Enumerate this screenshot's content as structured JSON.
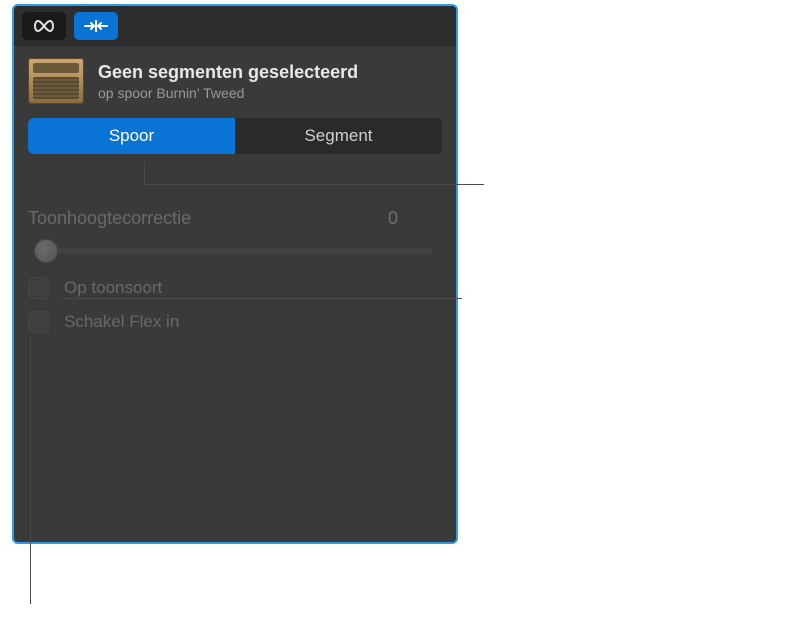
{
  "header": {
    "title": "Geen segmenten geselecteerd",
    "subtitle": "op spoor Burnin' Tweed"
  },
  "segmenter": {
    "track_label": "Spoor",
    "segment_label": "Segment"
  },
  "pitch": {
    "label": "Toonhoogtecorrectie",
    "value": "0"
  },
  "checks": {
    "limit_key": "Op toonsoort",
    "enable_flex": "Schakel Flex in"
  }
}
